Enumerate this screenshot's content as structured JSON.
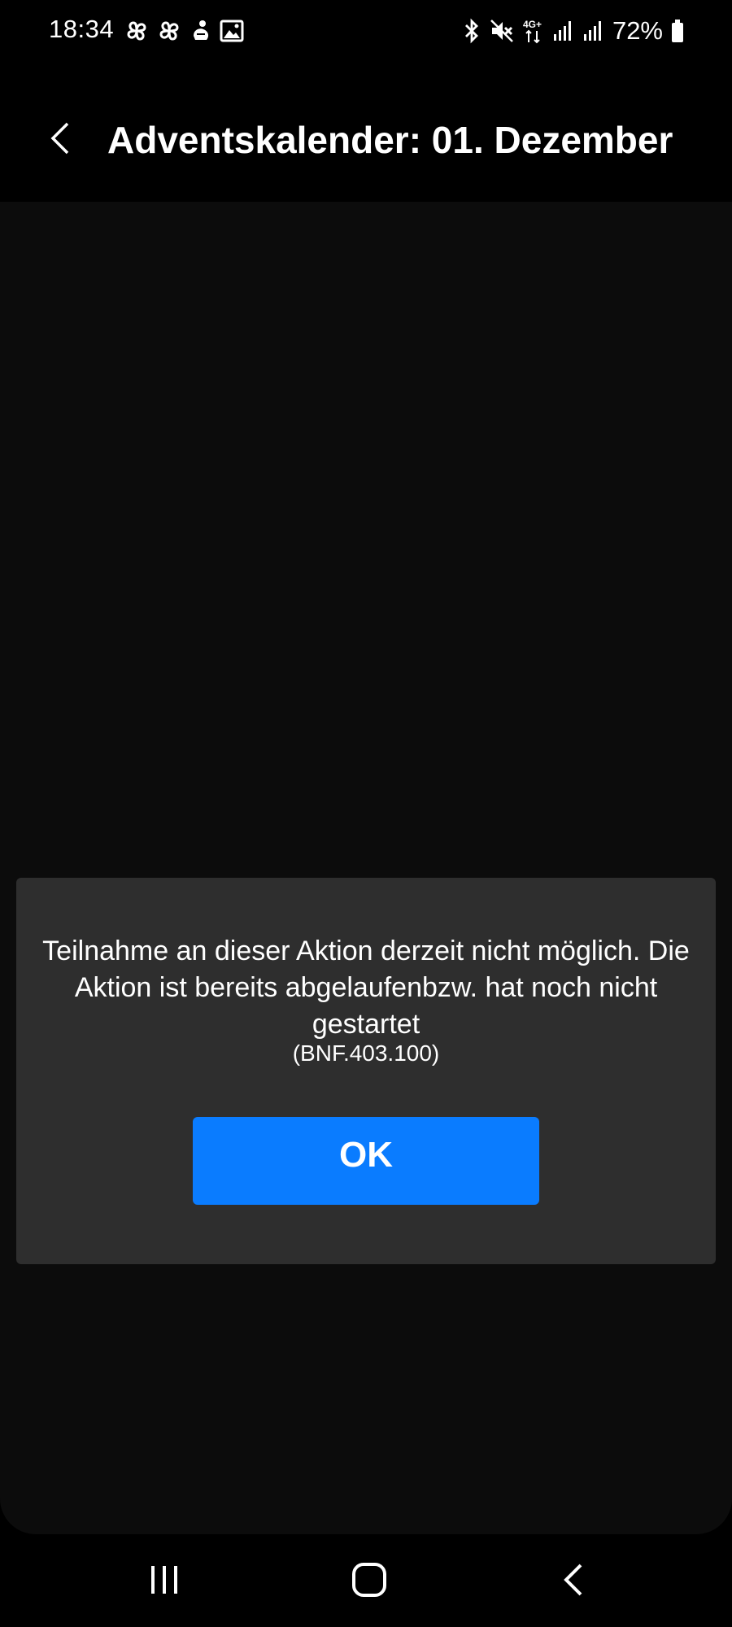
{
  "status_bar": {
    "time": "18:34",
    "left_icons": [
      "pinwheel-icon",
      "pinwheel-icon",
      "app-notification-icon",
      "gallery-icon"
    ],
    "right_icons": [
      "bluetooth-icon",
      "mute-icon",
      "4g-plus-icon",
      "signal-icon",
      "signal-icon",
      "battery-icon"
    ],
    "network_label": "4G+",
    "battery_percent": "72%"
  },
  "app_bar": {
    "title": "Adventskalender: 01. Dezember",
    "back_icon": "chevron-left-icon"
  },
  "dialog": {
    "message": "Teilnahme an dieser Aktion derzeit nicht möglich. Die Aktion ist bereits abgelaufenbzw. hat noch nicht gestartet",
    "error_code": "(BNF.403.100)",
    "ok_label": "OK",
    "button_color": "#0a7cff",
    "background_color": "#2e2e2e"
  },
  "nav_bar": {
    "items": [
      "recent-apps-icon",
      "home-icon",
      "back-icon"
    ]
  }
}
